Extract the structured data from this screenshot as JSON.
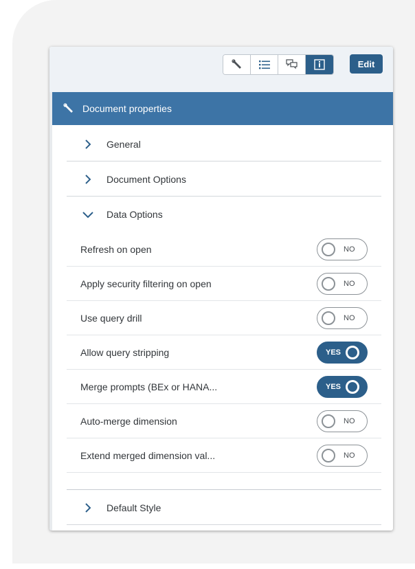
{
  "toolbar": {
    "buttons": [
      {
        "icon": "wrench-icon",
        "active": false
      },
      {
        "icon": "list-icon",
        "active": false
      },
      {
        "icon": "comments-icon",
        "active": false
      },
      {
        "icon": "info-icon",
        "active": true
      }
    ],
    "edit_label": "Edit"
  },
  "section": {
    "title": "Document properties",
    "icon": "wrench-icon"
  },
  "accordion": {
    "general": "General",
    "document_options": "Document Options",
    "data_options": "Data Options",
    "default_style": "Default Style"
  },
  "data_options": [
    {
      "label": "Refresh on open",
      "state": "NO"
    },
    {
      "label": "Apply security filtering on open",
      "state": "NO"
    },
    {
      "label": "Use query drill",
      "state": "NO"
    },
    {
      "label": "Allow query stripping",
      "state": "YES"
    },
    {
      "label": "Merge prompts (BEx or HANA...",
      "state": "YES"
    },
    {
      "label": "Auto-merge dimension",
      "state": "NO"
    },
    {
      "label": "Extend merged dimension val...",
      "state": "NO"
    }
  ],
  "colors": {
    "accent": "#2c5f8a",
    "header": "#3d74a6",
    "toolbar_bg": "#eef2f6"
  }
}
